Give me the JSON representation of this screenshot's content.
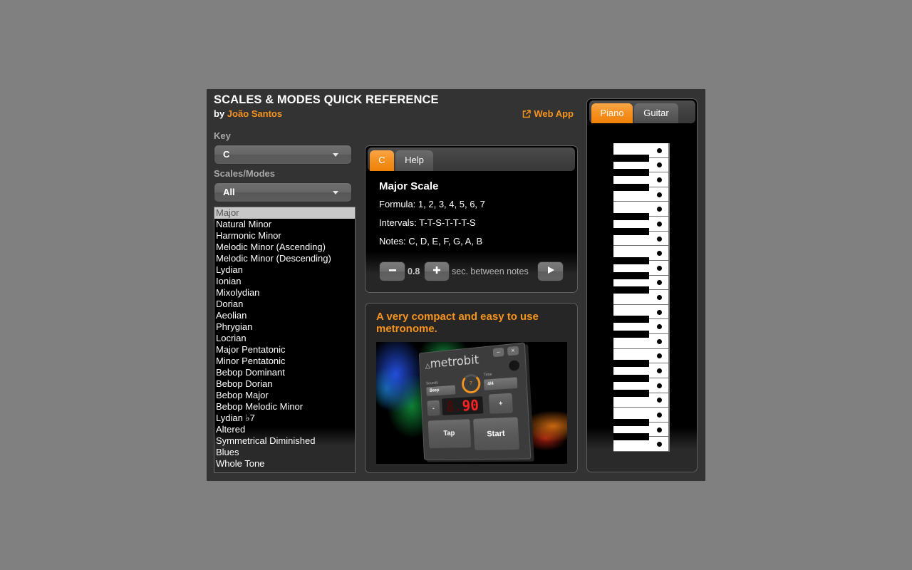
{
  "app": {
    "title": "SCALES & MODES QUICK REFERENCE",
    "by_label": "by",
    "author": "João Santos",
    "web_app_link": "Web App",
    "web_app_icon": "external-link-icon"
  },
  "controls": {
    "key_label": "Key",
    "key_value": "C",
    "scales_label": "Scales/Modes",
    "scales_value": "All"
  },
  "scale_list": {
    "selected": "Major",
    "items": [
      "Major",
      "Natural Minor",
      "Harmonic Minor",
      "Melodic Minor (Ascending)",
      "Melodic Minor (Descending)",
      "Lydian",
      "Ionian",
      "Mixolydian",
      "Dorian",
      "Aeolian",
      "Phrygian",
      "Locrian",
      "Major Pentatonic",
      "Minor Pentatonic",
      "Bebop Dominant",
      "Bebop Dorian",
      "Bebop Major",
      "Bebop Melodic Minor",
      "Lydian ♭7",
      "Altered",
      "Symmetrical Diminished",
      "Blues",
      "Whole Tone"
    ]
  },
  "scale_panel": {
    "tabs": [
      {
        "label": "C",
        "active": true
      },
      {
        "label": "Help",
        "active": false
      }
    ],
    "title": "Major Scale",
    "formula": {
      "label": "Formula:",
      "value": "1, 2, 3, 4, 5, 6, 7"
    },
    "intervals": {
      "label": "Intervals:",
      "value": "T-T-S-T-T-T-S"
    },
    "notes": {
      "label": "Notes:",
      "value": "C, D, E, F, G, A, B"
    },
    "playback": {
      "decrease_icon": "minus-icon",
      "delay_seconds": "0.8",
      "increase_icon": "plus-icon",
      "unit_label": "sec. between notes",
      "play_icon": "play-icon"
    }
  },
  "promo": {
    "headline": "A very compact and easy to use metronome.",
    "image": {
      "app_name": "metrobit",
      "minimize": "–",
      "close": "×",
      "sounds_label": "Sounds",
      "sound_value": "Beep",
      "volume_value": "7",
      "time_label": "Time",
      "time_value": "4/4",
      "minus": "-",
      "tempo_dim": "8.",
      "tempo": "90",
      "plus": "+",
      "tap": "Tap",
      "start": "Start"
    }
  },
  "instrument_panel": {
    "tabs": [
      {
        "label": "Piano",
        "active": true
      },
      {
        "label": "Guitar",
        "active": false
      }
    ],
    "piano": {
      "orientation": "vertical, highest note at top",
      "keys_top_to_bottom": [
        {
          "note": "B",
          "marked": true
        },
        {
          "note": "A#",
          "marked": false
        },
        {
          "note": "A",
          "marked": true
        },
        {
          "note": "G#",
          "marked": false
        },
        {
          "note": "G",
          "marked": true
        },
        {
          "note": "F#",
          "marked": false
        },
        {
          "note": "F",
          "marked": true
        },
        {
          "note": "E",
          "marked": true
        },
        {
          "note": "D#",
          "marked": false
        },
        {
          "note": "D",
          "marked": true
        },
        {
          "note": "C#",
          "marked": false
        },
        {
          "note": "C",
          "marked": true
        },
        {
          "note": "B",
          "marked": true
        },
        {
          "note": "A#",
          "marked": false
        },
        {
          "note": "A",
          "marked": true
        },
        {
          "note": "G#",
          "marked": false
        },
        {
          "note": "G",
          "marked": true
        },
        {
          "note": "F#",
          "marked": false
        },
        {
          "note": "F",
          "marked": true
        },
        {
          "note": "E",
          "marked": true
        },
        {
          "note": "D#",
          "marked": false
        },
        {
          "note": "D",
          "marked": true
        },
        {
          "note": "C#",
          "marked": false
        },
        {
          "note": "C",
          "marked": true
        },
        {
          "note": "B",
          "marked": true
        },
        {
          "note": "A#",
          "marked": false
        },
        {
          "note": "A",
          "marked": true
        },
        {
          "note": "G#",
          "marked": false
        },
        {
          "note": "G",
          "marked": true
        },
        {
          "note": "F#",
          "marked": false
        },
        {
          "note": "F",
          "marked": true
        },
        {
          "note": "E",
          "marked": true
        },
        {
          "note": "D#",
          "marked": false
        },
        {
          "note": "D",
          "marked": true
        },
        {
          "note": "C#",
          "marked": false
        },
        {
          "note": "C",
          "marked": true
        }
      ]
    }
  },
  "colors": {
    "accent": "#f7931e",
    "page_bg": "#808080",
    "app_bg": "#333333",
    "selected_item_bg": "#c8c8c8"
  }
}
